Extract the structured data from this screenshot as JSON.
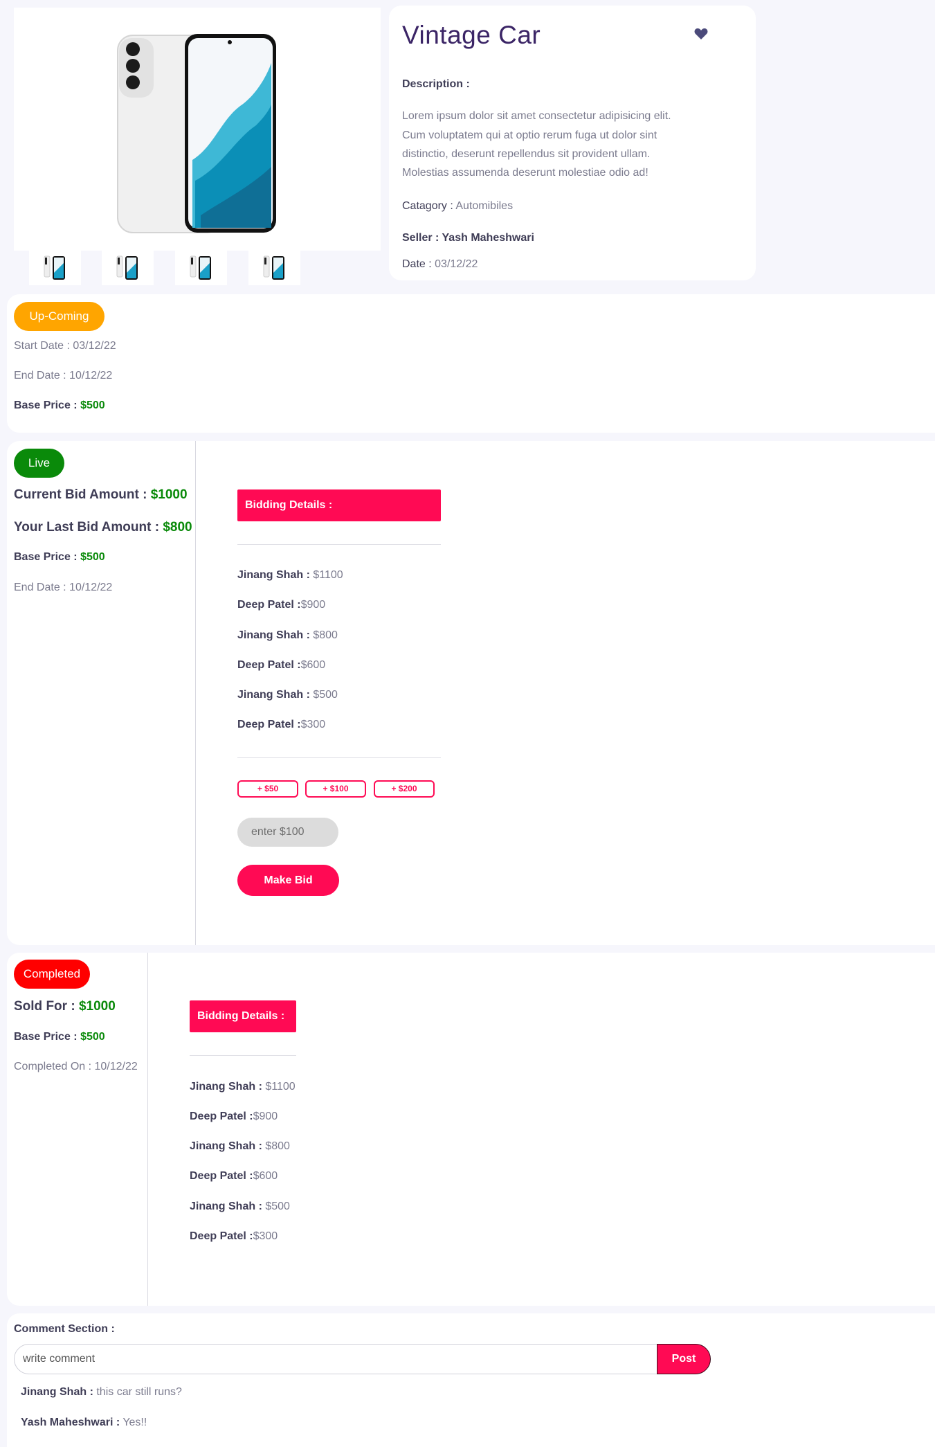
{
  "product": {
    "title": "Vintage Car",
    "description_label": "Description :",
    "description_lines": [
      "Lorem ipsum dolor sit amet consectetur adipisicing elit.",
      "Cum voluptatem qui at optio rerum fuga ut dolor sint",
      "distinctio, deserunt repellendus sit provident ullam.",
      "Molestias assumenda deserunt molestiae odio ad!"
    ],
    "category_label": "Catagory :",
    "category_value": "Automibiles",
    "seller_label": "Seller : Yash Maheshwari",
    "date_label": "Date :",
    "date_value": "03/12/22"
  },
  "upcoming": {
    "badge": "Up-Coming",
    "start_date": "Start Date : 03/12/22",
    "end_date": "End Date : 10/12/22",
    "base_price_label": "Base Price :",
    "base_price_value": "$500"
  },
  "live": {
    "badge": "Live",
    "current_bid_label": "Current Bid Amount :",
    "current_bid_value": "$1000",
    "last_bid_label": "Your Last Bid Amount :",
    "last_bid_value": "$800",
    "base_price_label": "Base Price :",
    "base_price_value": "$500",
    "end_date": "End Date : 10/12/22",
    "bidding_header": "Bidding Details :",
    "bids": [
      {
        "name": "Jinang Shah :",
        "amount": " $1100"
      },
      {
        "name": "Deep Patel :",
        "amount": "$900"
      },
      {
        "name": "Jinang Shah :",
        "amount": " $800"
      },
      {
        "name": "Deep Patel :",
        "amount": "$600"
      },
      {
        "name": "Jinang Shah :",
        "amount": " $500"
      },
      {
        "name": "Deep Patel :",
        "amount": "$300"
      }
    ],
    "increments": [
      "+ $50",
      "+ $100",
      "+ $200"
    ],
    "bid_input_placeholder": "enter $100",
    "make_bid": "Make Bid"
  },
  "completed": {
    "badge": "Completed",
    "sold_for_label": "Sold For :",
    "sold_for_value": "$1000",
    "base_price_label": "Base Price :",
    "base_price_value": "$500",
    "completed_on": "Completed On : 10/12/22",
    "bidding_header": "Bidding Details :",
    "bids": [
      {
        "name": "Jinang Shah :",
        "amount": " $1100"
      },
      {
        "name": "Deep Patel :",
        "amount": "$900"
      },
      {
        "name": "Jinang Shah :",
        "amount": " $800"
      },
      {
        "name": "Deep Patel :",
        "amount": "$600"
      },
      {
        "name": "Jinang Shah :",
        "amount": " $500"
      },
      {
        "name": "Deep Patel :",
        "amount": "$300"
      }
    ]
  },
  "comments": {
    "label": "Comment Section :",
    "input_placeholder": "write comment",
    "post": "Post",
    "items": [
      {
        "author": "Jinang Shah :",
        "text": " this car still runs?"
      },
      {
        "author": "Yash Maheshwari :",
        "text": " Yes!!"
      }
    ]
  },
  "colors": {
    "accent": "#ff0a54",
    "upcoming": "#ffa500",
    "live": "#0a8a0a",
    "completed": "#ff0000",
    "price_green": "#0a8a0a",
    "title": "#3b2566"
  },
  "icons": [
    "favorite-heart-icon"
  ]
}
